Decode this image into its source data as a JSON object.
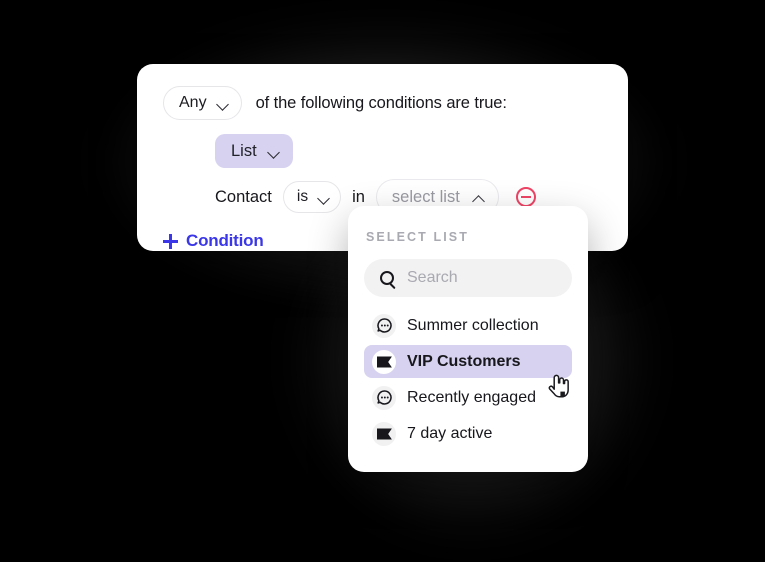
{
  "condition_card": {
    "match_select": {
      "value": "Any",
      "icon": "chevron-down-icon"
    },
    "intro_text": "of the following conditions are true:",
    "field_pill": {
      "value": "List",
      "icon": "chevron-down-icon"
    },
    "subject_label": "Contact",
    "operator_select": {
      "value": "is",
      "icon": "chevron-down-icon"
    },
    "joiner_text": "in",
    "value_select": {
      "value": "select list",
      "icon": "chevron-up-icon"
    },
    "remove_icon": "minus-circle-icon",
    "add_condition": {
      "label": "Condition",
      "icon": "plus-icon"
    }
  },
  "dropdown": {
    "title": "SELECT LIST",
    "search": {
      "value": "",
      "placeholder": "Search",
      "icon": "search-icon"
    },
    "options": [
      {
        "label": "Summer collection",
        "icon": "chat-bubble-icon",
        "selected": false
      },
      {
        "label": "VIP Customers",
        "icon": "flag-icon",
        "selected": true
      },
      {
        "label": "Recently engaged",
        "icon": "chat-bubble-icon",
        "selected": false
      },
      {
        "label": "7 day active",
        "icon": "flag-icon",
        "selected": false
      }
    ]
  },
  "cursor": {
    "icon": "pointing-hand-cursor"
  },
  "colors": {
    "background": "#000000",
    "card": "#ffffff",
    "accent_lavender": "#d6d2f0",
    "accent_blue": "#3b37e8",
    "danger_red": "#ef4466",
    "muted_text": "#a9a9b2"
  }
}
